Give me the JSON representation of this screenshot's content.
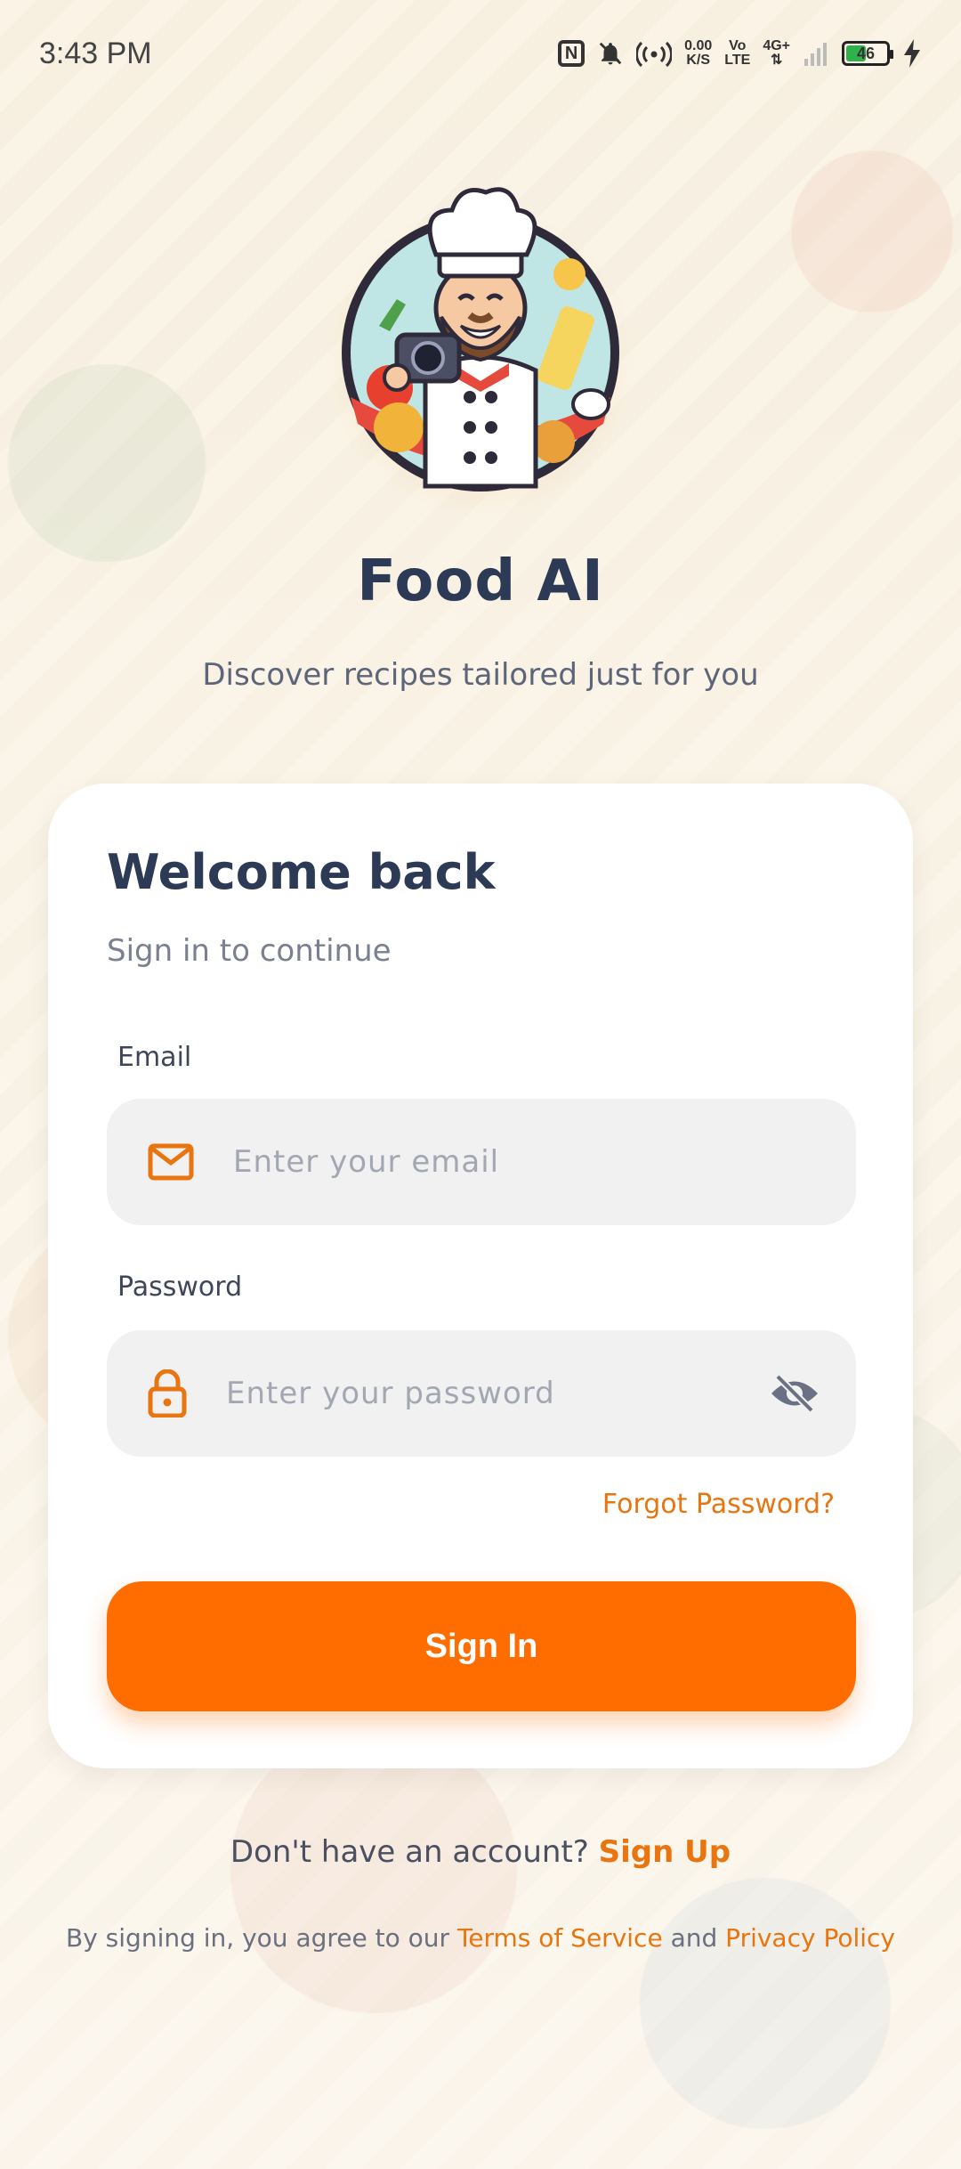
{
  "status_bar": {
    "time": "3:43 PM",
    "speed_value": "0.00",
    "speed_unit": "K/S",
    "volte_top": "Vo",
    "volte_bottom": "LTE",
    "network": "4G+",
    "battery_percent": "46",
    "battery_color": "#2fb24c"
  },
  "header": {
    "title": "Food AI",
    "subtitle": "Discover recipes tailored just for you"
  },
  "login_card": {
    "title": "Welcome back",
    "subtitle": "Sign in to continue",
    "email_label": "Email",
    "email_placeholder": "Enter your email",
    "password_label": "Password",
    "password_placeholder": "Enter your password",
    "forgot_password": "Forgot Password?",
    "sign_in_button": "Sign In"
  },
  "footer": {
    "no_account_text": "Don't have an account?",
    "sign_up_link": "Sign Up",
    "terms_prefix": "By signing in, you agree to our",
    "terms_link": "Terms of Service",
    "terms_and": "and",
    "privacy_link": "Privacy Policy"
  },
  "icons": {
    "email": "mail-icon",
    "password": "lock-icon",
    "visibility": "eye-off-icon",
    "logo": "chef-mascot-logo"
  },
  "colors": {
    "accent": "#ff6d00",
    "title": "#2c3a55",
    "field_bg": "#f1f1f2"
  }
}
